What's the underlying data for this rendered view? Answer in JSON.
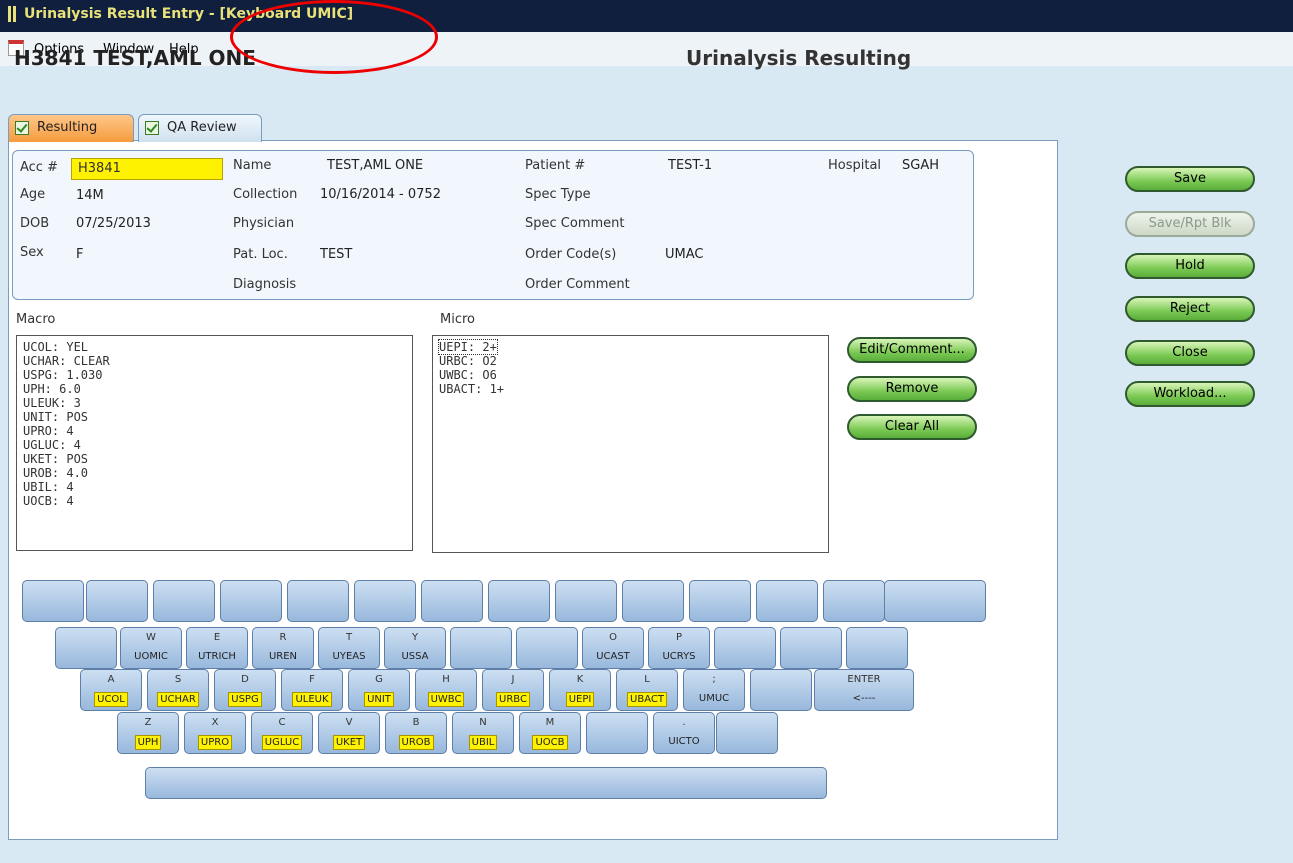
{
  "window": {
    "title": "Urinalysis Result Entry - [Keyboard UMIC]"
  },
  "menu": [
    {
      "label": "Options"
    },
    {
      "label": "Window"
    },
    {
      "label": "Help"
    }
  ],
  "header": {
    "patient": "H3841 TEST,AML ONE",
    "heading": "Urinalysis Resulting"
  },
  "tabs": [
    {
      "label": "Resulting",
      "active": true
    },
    {
      "label": "QA Review",
      "active": false
    }
  ],
  "info": {
    "acc_label": "Acc #",
    "acc_value": "H3841",
    "age_label": "Age",
    "age_value": "14M",
    "dob_label": "DOB",
    "dob_value": "07/25/2013",
    "sex_label": "Sex",
    "sex_value": "F",
    "name_label": "Name",
    "name_value": "TEST,AML ONE",
    "collection_label": "Collection",
    "collection_value": "10/16/2014 - 0752",
    "physician_label": "Physician",
    "patloc_label": "Pat. Loc.",
    "patloc_value": "TEST",
    "diagnosis_label": "Diagnosis",
    "patientnum_label": "Patient #",
    "patientnum_value": "TEST-1",
    "spectype_label": "Spec Type",
    "speccomment_label": "Spec Comment",
    "ordercode_label": "Order Code(s)",
    "ordercode_value": "UMAC",
    "ordercomment_label": "Order Comment",
    "hospital_label": "Hospital",
    "hospital_value": "SGAH"
  },
  "macro": {
    "label": "Macro",
    "items": [
      "UCOL: YEL",
      "UCHAR: CLEAR",
      "USPG: 1.030",
      "UPH: 6.0",
      "ULEUK: 3",
      "UNIT: POS",
      "UPRO: 4",
      "UGLUC: 4",
      "UKET: POS",
      "UROB: 4.0",
      "UBIL: 4",
      "UOCB: 4"
    ]
  },
  "micro": {
    "label": "Micro",
    "items": [
      "UEPI: 2+",
      "URBC: O2",
      "UWBC: O6",
      "UBACT: 1+"
    ]
  },
  "micro_buttons": {
    "edit": "Edit/Comment...",
    "remove": "Remove",
    "clear": "Clear All"
  },
  "side_buttons": {
    "save": "Save",
    "save_rpt": "Save/Rpt Blk",
    "hold": "Hold",
    "reject": "Reject",
    "close": "Close",
    "workload": "Workload..."
  },
  "keyboard": {
    "row2": [
      {
        "k": "",
        "c": ""
      },
      {
        "k": "W",
        "c": "UOMIC"
      },
      {
        "k": "E",
        "c": "UTRICH"
      },
      {
        "k": "R",
        "c": "UREN"
      },
      {
        "k": "T",
        "c": "UYEAS"
      },
      {
        "k": "Y",
        "c": "USSA"
      },
      {
        "k": "",
        "c": ""
      },
      {
        "k": "",
        "c": ""
      },
      {
        "k": "O",
        "c": "UCAST"
      },
      {
        "k": "P",
        "c": "UCRYS"
      },
      {
        "k": "",
        "c": ""
      },
      {
        "k": "",
        "c": ""
      },
      {
        "k": "",
        "c": ""
      }
    ],
    "row3": [
      {
        "k": "A",
        "c": "UCOL"
      },
      {
        "k": "S",
        "c": "UCHAR"
      },
      {
        "k": "D",
        "c": "USPG"
      },
      {
        "k": "F",
        "c": "ULEUK"
      },
      {
        "k": "G",
        "c": "UNIT"
      },
      {
        "k": "H",
        "c": "UWBC"
      },
      {
        "k": "J",
        "c": "URBC"
      },
      {
        "k": "K",
        "c": "UEPI"
      },
      {
        "k": "L",
        "c": "UBACT"
      },
      {
        "k": ";",
        "c": "UMUC"
      },
      {
        "k": "",
        "c": ""
      },
      {
        "k": "ENTER",
        "c": "<----"
      }
    ],
    "row4": [
      {
        "k": "Z",
        "c": "UPH"
      },
      {
        "k": "X",
        "c": "UPRO"
      },
      {
        "k": "C",
        "c": "UGLUC"
      },
      {
        "k": "V",
        "c": "UKET"
      },
      {
        "k": "B",
        "c": "UROB"
      },
      {
        "k": "N",
        "c": "UBIL"
      },
      {
        "k": "M",
        "c": "UOCB"
      },
      {
        "k": "",
        "c": ""
      },
      {
        "k": ".",
        "c": "UICTO"
      },
      {
        "k": "",
        "c": ""
      }
    ]
  }
}
